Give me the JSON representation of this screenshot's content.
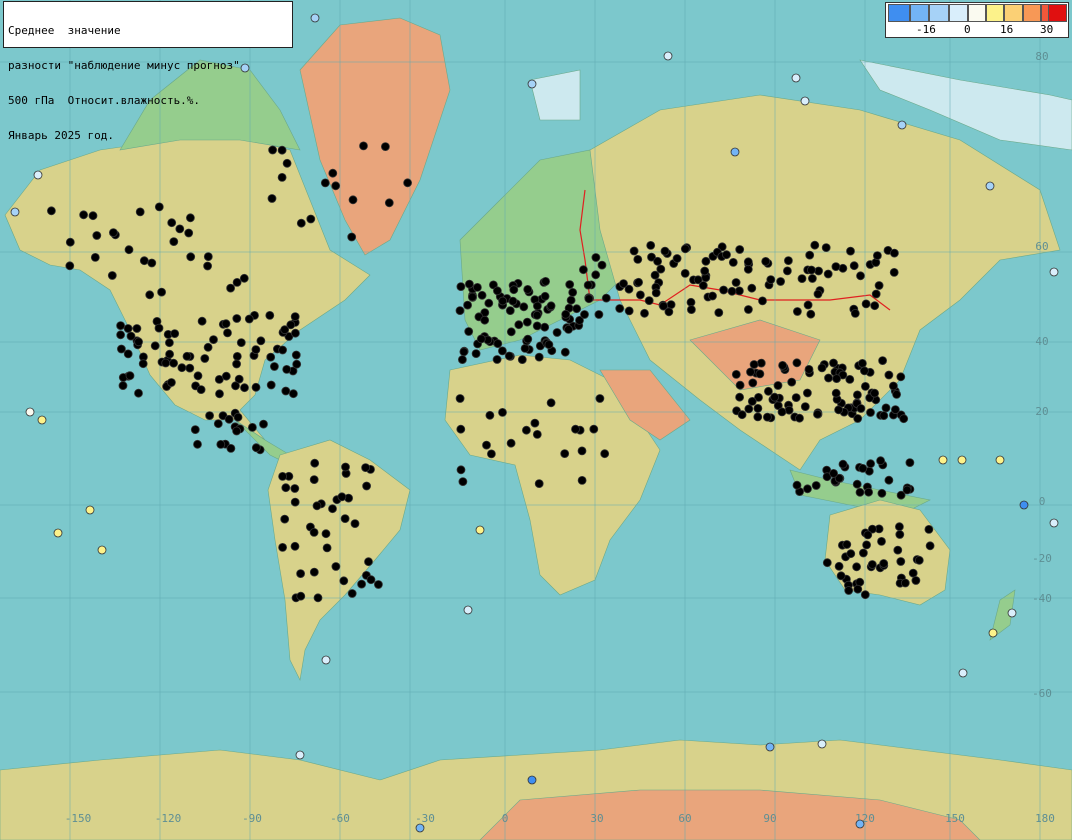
{
  "title_lines": [
    "Среднее  значение",
    "разности \"наблюдение минус прогноз\"",
    "500 гПа  Относит.влажность.%.",
    "Январь 2025 год."
  ],
  "legend": {
    "colors": [
      "#3f8ef0",
      "#73b4f5",
      "#a6d2f7",
      "#d9eefb",
      "#fafaf0",
      "#fcf28a",
      "#fbd075",
      "#f79856",
      "#f0583a",
      "#e01010"
    ],
    "ticks": [
      "-16",
      "0",
      "16",
      "30"
    ]
  },
  "lon_labels": [
    "-150",
    "-120",
    "-90",
    "-60",
    "-30",
    "0",
    "30",
    "60",
    "90",
    "120",
    "150",
    "180"
  ],
  "lat_labels": [
    "80",
    "60",
    "40",
    "20",
    "0",
    "-20",
    "-40",
    "-60"
  ],
  "colors": {
    "ocean": "#7cc8cc",
    "land_low": "#95cd8d",
    "land_mid": "#d8d28b",
    "land_high": "#e9a57c",
    "ice": "#cde9ef",
    "grid": "#5fa8b0",
    "border": "#e02020"
  }
}
